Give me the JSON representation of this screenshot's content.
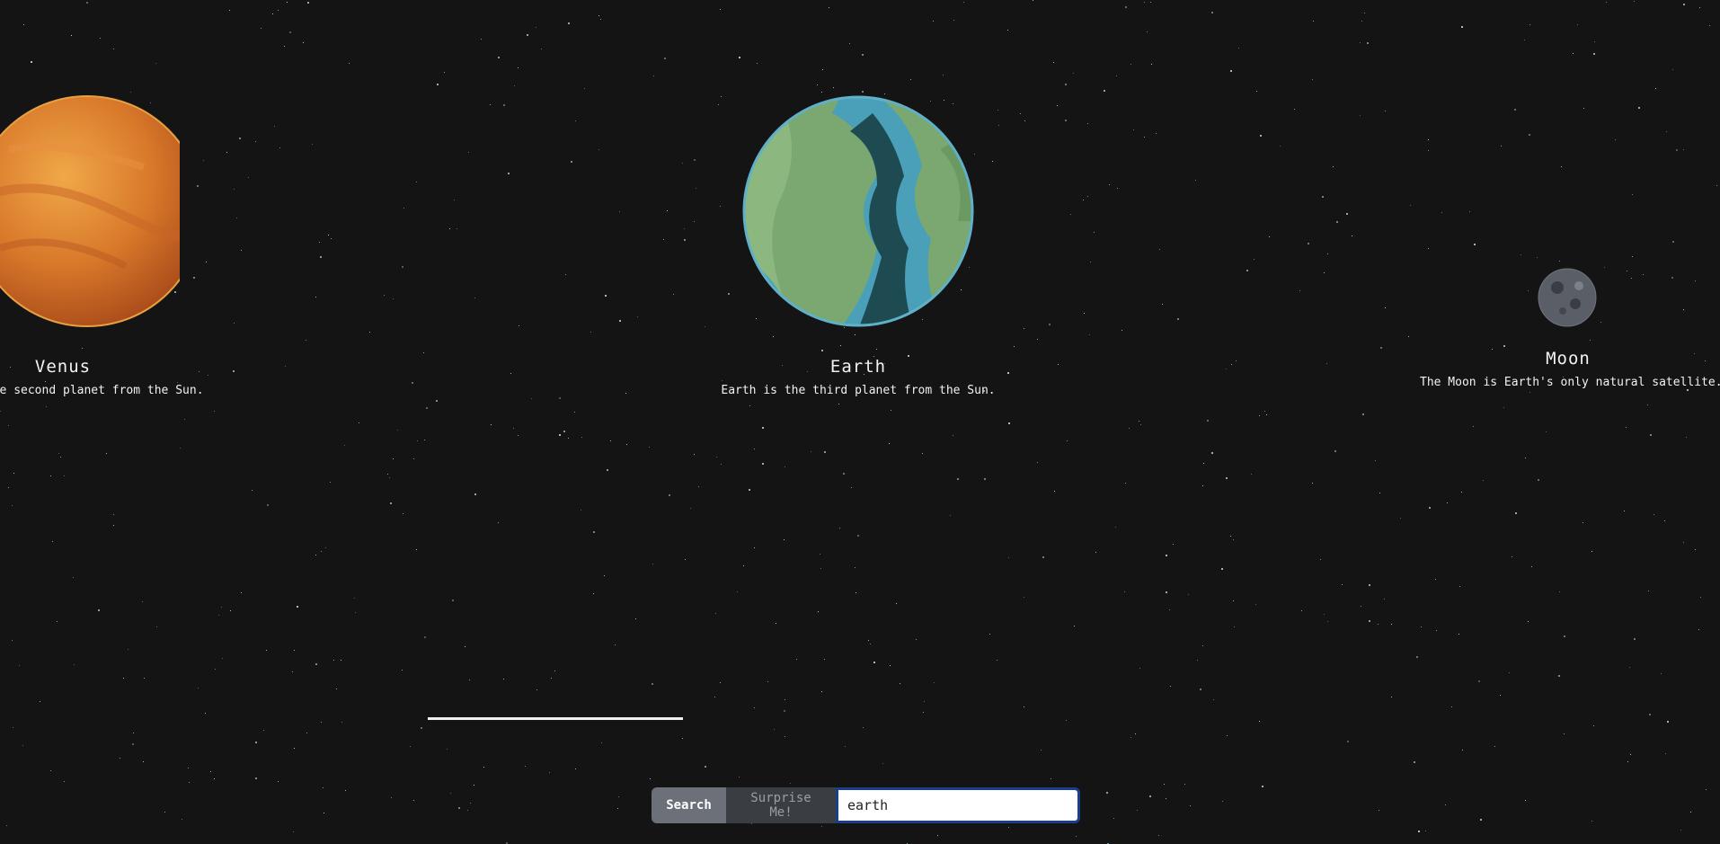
{
  "bodies": [
    {
      "key": "venus",
      "name": "Venus",
      "description": "Venus is the second planet from the Sun.",
      "colors": {
        "light": "#f0a848",
        "mid": "#d8782a",
        "dark": "#a84a1a",
        "rim": "#e8a040"
      }
    },
    {
      "key": "earth",
      "name": "Earth",
      "description": "Earth is the third planet from the Sun.",
      "colors": {
        "ocean": "#1e4a52",
        "shallow": "#4aa0b8",
        "land": "#7aa870",
        "rim": "#5fb0c8"
      }
    },
    {
      "key": "moon",
      "name": "Moon",
      "description": "The Moon is Earth's only natural satellite.",
      "colors": {
        "surface": "#5a5e66",
        "dark": "#3a3d44",
        "light": "#8a8e96"
      }
    }
  ],
  "controls": {
    "search_label": "Search",
    "surprise_label": "Surprise Me!",
    "search_value": "earth"
  },
  "colors": {
    "background": "#141414",
    "star": "#a9d4e6",
    "input_border": "#1b3d8f"
  }
}
